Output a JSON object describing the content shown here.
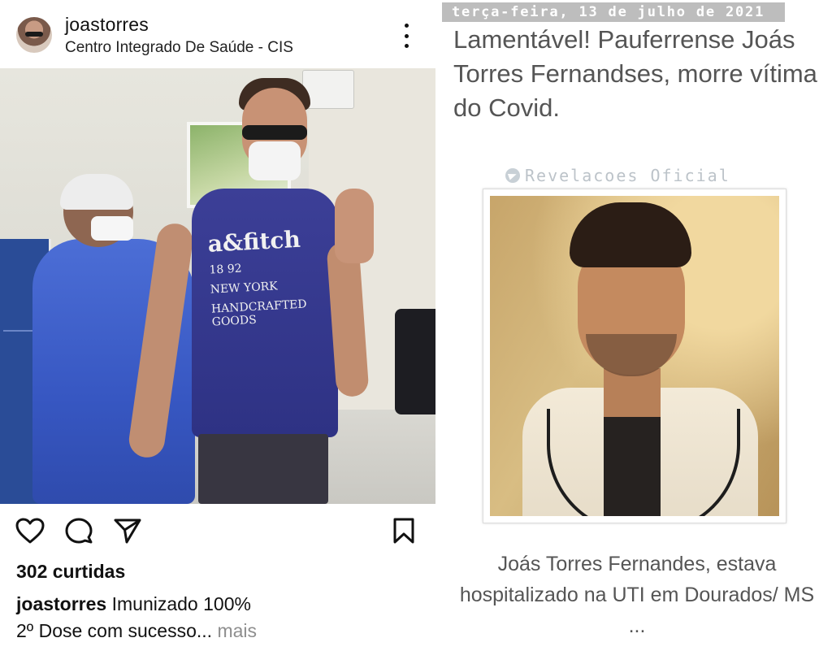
{
  "instagram": {
    "username": "joastorres",
    "location": "Centro Integrado De Saúde - CIS",
    "likes": "302 curtidas",
    "caption_user": "joastorres",
    "caption_text": " Imunizado 100%",
    "caption_line2": "2º Dose com sucesso",
    "caption_ellipsis": "...",
    "more_label": " mais",
    "shirt_line1": "a&fitch",
    "shirt_line2": "18 92",
    "shirt_line3": "NEW YORK",
    "shirt_line4": "HANDCRAFTED GOODS",
    "icons": {
      "more": "more-vertical-icon",
      "like": "heart-icon",
      "comment": "comment-icon",
      "share": "send-icon",
      "save": "bookmark-icon"
    }
  },
  "news": {
    "date": "terça-feira, 13 de julho de 2021",
    "headline": "Lamentável! Pauferrense Joás Torres Fernandses, morre vítima do Covid.",
    "watermark": "Revelacoes Oficial",
    "caption": "Joás Torres Fernandes, estava hospitalizado na UTI em Dourados/ MS ...",
    "colors": {
      "date_bar": "#bdbdbd",
      "text": "#555555",
      "watermark": "#bcc3c9"
    }
  }
}
